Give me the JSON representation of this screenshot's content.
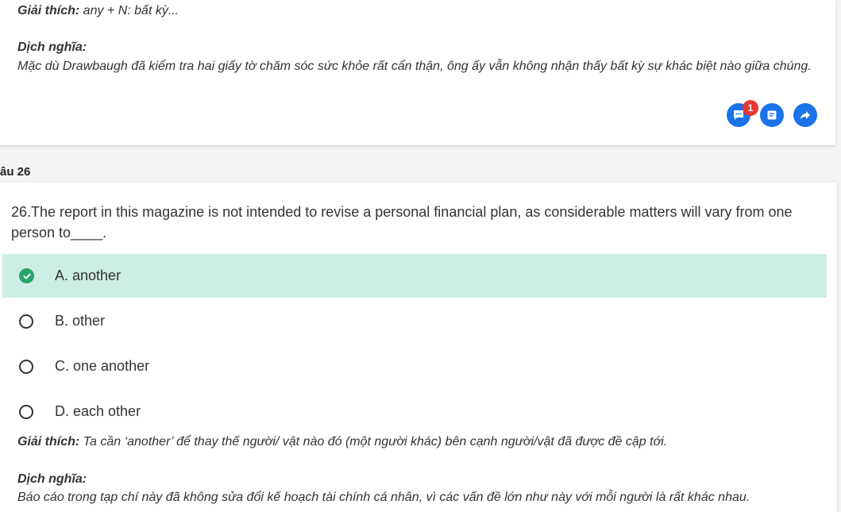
{
  "prev": {
    "explanation_label": "Giải thích:",
    "explanation_text": " any + N: bất kỳ...",
    "translation_label": "Dịch nghĩa:",
    "translation_text": "Mặc dù Drawbaugh đã kiểm tra hai giấy tờ chăm sóc sức khỏe rất cẩn thận, ông ấy vẫn không nhận thấy bất kỳ sự khác biệt nào giữa chúng.",
    "comment_badge": "1",
    "icons": [
      "comment-icon",
      "note-icon",
      "share-icon"
    ]
  },
  "question": {
    "label": "âu 26",
    "text": "26.The report in this magazine is not intended to revise a personal financial plan, as considerable matters will vary from one person to____.",
    "options": [
      {
        "label": "A. another",
        "state": "correct"
      },
      {
        "label": "B. other",
        "state": "unselected"
      },
      {
        "label": "C. one another",
        "state": "unselected"
      },
      {
        "label": "D. each other",
        "state": "unselected"
      }
    ],
    "explanation_label": "Giải thích:",
    "explanation_text": " Ta cần ‘another’ để thay thế người/ vật nào đó (một người khác) bên cạnh người/vật đã được đề cập tới.",
    "translation_label": "Dịch nghĩa:",
    "translation_text": "Báo cáo trong tạp chí này đã không sửa đổi kế hoạch tài chính cá nhân, vì các vấn đề lớn như này với mỗi người là rất khác nhau."
  },
  "colors": {
    "accent": "#1a73e8",
    "correct_bg": "#cdeee4",
    "correct_icon": "#27a46b",
    "badge": "#e53935"
  }
}
